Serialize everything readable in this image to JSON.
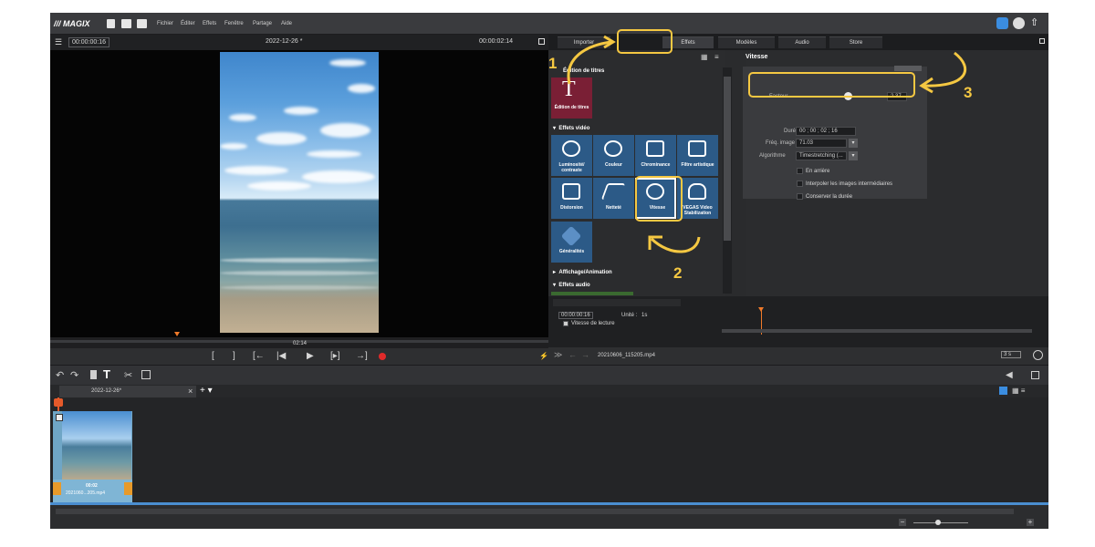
{
  "menubar": {
    "logo": "MAGIX",
    "menus": [
      "Fichier",
      "Éditer",
      "Effets",
      "Fenêtre",
      "Partage",
      "Aide"
    ]
  },
  "preview": {
    "timecode": "00:00:00:16",
    "project_title": "2022-12-26 *",
    "duration": "00:00:02:14",
    "scrub_label": "02:14",
    "transport": [
      "[",
      "]",
      "[←",
      "|◀",
      "▶",
      "[▸]",
      "→]"
    ]
  },
  "tabs": [
    "Importer",
    "Effets",
    "Modèles",
    "Audio",
    "Store"
  ],
  "effects": {
    "edition_header": "Édition de titres",
    "edition_tile": "Édition de titres",
    "video_section": "Effets vidéo",
    "tiles": [
      "Luminosité/ contraste",
      "Couleur",
      "Chrominance",
      "Filtre artistique",
      "Distorsion",
      "Netteté",
      "Vitesse",
      "VEGAS Video Stabilization",
      "Généralités"
    ],
    "anim_section": "Affichage/Animation",
    "audio_section": "Effets audio"
  },
  "vitesse": {
    "title": "Vitesse",
    "factor_label": "Facteur",
    "factor_value": "2.37",
    "factor_fraction": 0.58,
    "duration_label": "Durée",
    "duration_value": "00 ; 00 ; 02 ; 16",
    "freq_label": "Fréq. image",
    "freq_value": "71.03",
    "algo_label": "Algorithme",
    "algo_value": "Timestretching (...",
    "checkboxes": [
      "En arrière",
      "Interpoler les images intermédiaires",
      "Conserver la durée"
    ]
  },
  "mini_timeline": {
    "timecode": "00:00:00:16",
    "unit_label": "Unité :",
    "unit_value": "1s",
    "track": "Vitesse de lecture"
  },
  "media_bar": {
    "filename": "20210606_115205.mp4",
    "zoom": "3 s"
  },
  "project_tab": "2022-12-26*",
  "clip": {
    "duration": "00:02",
    "name": "2021060...205.mp4"
  },
  "annotations": [
    "1",
    "2",
    "3"
  ],
  "colors": {
    "accent": "#f5c842",
    "tile": "#2c5a87",
    "edition": "#7a1f35",
    "record": "#e02a2a",
    "playhead": "#f07a2a"
  }
}
